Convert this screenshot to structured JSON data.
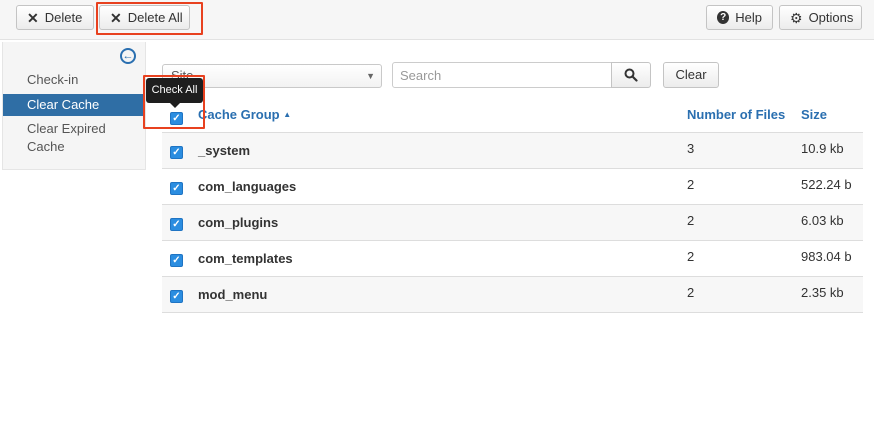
{
  "toolbar": {
    "delete_label": "Delete",
    "delete_all_label": "Delete All",
    "help_label": "Help",
    "options_label": "Options"
  },
  "sidebar": {
    "items": [
      {
        "label": "Check-in"
      },
      {
        "label": "Clear Cache"
      },
      {
        "label": "Clear Expired Cache"
      }
    ]
  },
  "filters": {
    "site_select_value": "Site",
    "search_placeholder": "Search",
    "clear_label": "Clear"
  },
  "tooltip": {
    "text": "Check All"
  },
  "table": {
    "headers": {
      "group": "Cache Group",
      "sort_indicator": "▲",
      "files": "Number of Files",
      "size": "Size"
    },
    "rows": [
      {
        "group": "_system",
        "files": "3",
        "size": "10.9 kb"
      },
      {
        "group": "com_languages",
        "files": "2",
        "size": "522.24 b"
      },
      {
        "group": "com_plugins",
        "files": "2",
        "size": "6.03 kb"
      },
      {
        "group": "com_templates",
        "files": "2",
        "size": "983.04 b"
      },
      {
        "group": "mod_menu",
        "files": "2",
        "size": "2.35 kb"
      }
    ]
  },
  "colors": {
    "accent": "#2a6fb0",
    "active_sidebar": "#2f6ea5",
    "highlight": "#e8411f",
    "checkbox": "#2b8de0"
  },
  "icons": {
    "delete": "close-icon",
    "delete_all": "close-icon",
    "help": "help-icon",
    "options": "gear-icon",
    "sidebar_toggle": "arrow-left-circle-icon",
    "search": "search-icon"
  }
}
